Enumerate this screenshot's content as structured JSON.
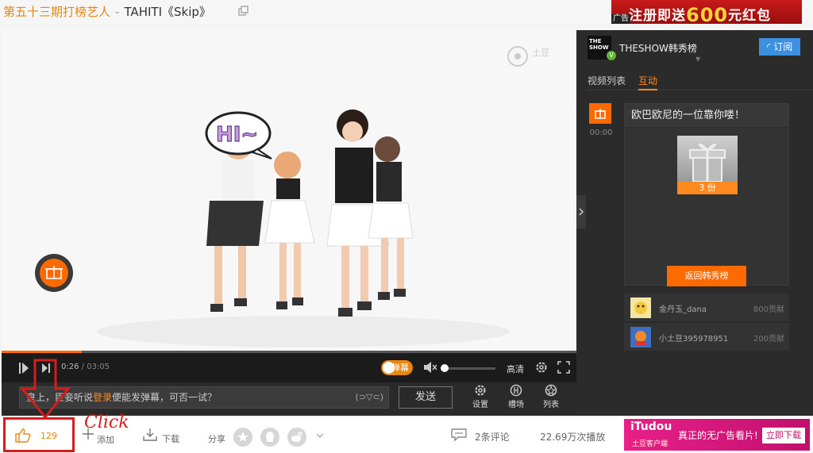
{
  "header": {
    "title_prefix": "第五十三期打榜艺人",
    "title_sep": "-",
    "title_main": "TAHITI《Skip》",
    "ad_text": "注册即送",
    "ad_amount": "600",
    "ad_suffix": "元红包",
    "ad_tag": "广告"
  },
  "video": {
    "speech_bubble": "HI~",
    "watermark": "土豆"
  },
  "controls": {
    "current_time": "0:26",
    "duration": "/ 03:05",
    "progress": 0.14,
    "danmu_label": "弹幕",
    "quality_label": "高清",
    "volume": 0
  },
  "danmu_bar": {
    "placeholder_a": "皇上，臣妾听说",
    "placeholder_login": "登录",
    "placeholder_b": "便能发弹幕，可否一试？",
    "emoticon": "(⊃▽⊂)",
    "send_label": "发送",
    "tools": [
      "设置",
      "槽场",
      "列表"
    ]
  },
  "side": {
    "channel_logo": "THE SHOW",
    "channel_name": "THESHOW韩秀榜",
    "subscribe_label": "订阅",
    "tabs": [
      "视频列表",
      "互动"
    ],
    "active_tab": 1,
    "gift_time": "00:00",
    "card_title": "欧巴欧尼的一位靠你喽！",
    "gift_count": "3 份",
    "return_label": "返回韩秀榜",
    "ranks": [
      {
        "name": "金丹玉_dana",
        "points": "800贡献"
      },
      {
        "name": "小土豆395978951",
        "points": "200贡献"
      }
    ]
  },
  "bottom": {
    "like_count": "129",
    "click_annotation": "Click",
    "add_label": "添加",
    "download_label": "下载",
    "share_label": "分享",
    "comments_label": "2条评论",
    "plays_label": "22.69万次播放",
    "ad_brand": "iTudou",
    "ad_sub": "土豆客户端",
    "ad_slogan": "真正的无广告看片!",
    "ad_button": "立即下载"
  },
  "colors": {
    "accent": "#ff6a00",
    "annotation_red": "#d61d1d",
    "subscribe_blue": "#3d8fe0"
  }
}
